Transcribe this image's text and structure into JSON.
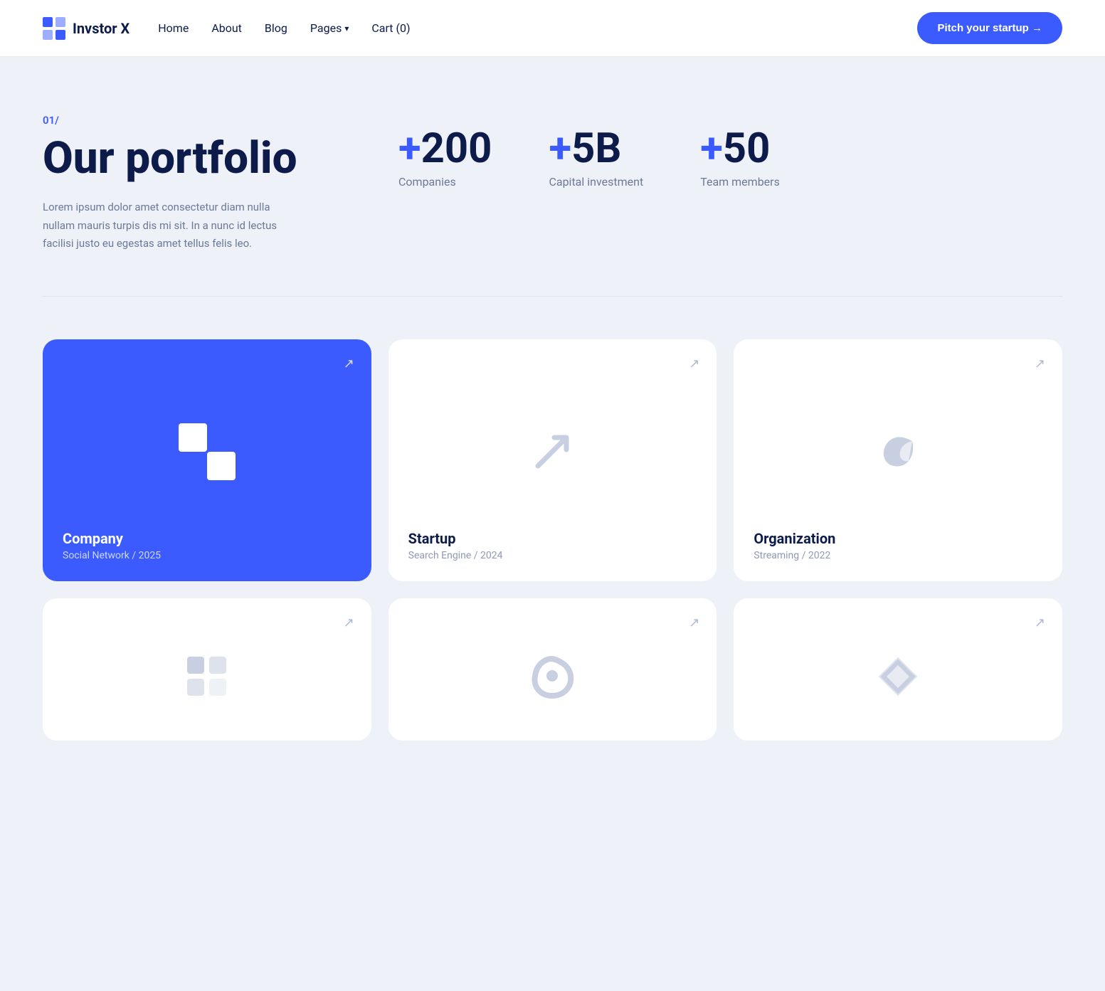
{
  "brand": {
    "name": "Invstor X"
  },
  "nav": {
    "links": [
      {
        "label": "Home",
        "id": "home"
      },
      {
        "label": "About",
        "id": "about"
      },
      {
        "label": "Blog",
        "id": "blog"
      },
      {
        "label": "Pages",
        "id": "pages"
      },
      {
        "label": "Cart (0)",
        "id": "cart"
      }
    ],
    "cta_label": "Pitch your startup →"
  },
  "portfolio": {
    "section_number": "01/",
    "title": "Our portfolio",
    "description": "Lorem ipsum dolor amet consectetur diam nulla nullam mauris turpis dis mi sit. In a nunc id lectus facilisi justo eu egestas amet tellus felis leo.",
    "stats": [
      {
        "value": "+200",
        "label": "Companies"
      },
      {
        "value": "+5B",
        "label": "Capital investment"
      },
      {
        "value": "+50",
        "label": "Team members"
      }
    ]
  },
  "cards": {
    "row1": [
      {
        "id": "card-company",
        "title": "Company",
        "subtitle": "Social Network / 2025",
        "type": "blue",
        "logo_type": "squares"
      },
      {
        "id": "card-startup",
        "title": "Startup",
        "subtitle": "Search Engine / 2024",
        "type": "white",
        "logo_type": "arrow"
      },
      {
        "id": "card-organization",
        "title": "Organization",
        "subtitle": "Streaming / 2022",
        "type": "white",
        "logo_type": "g"
      }
    ],
    "row2": [
      {
        "id": "card-4",
        "title": "",
        "subtitle": "",
        "type": "white",
        "logo_type": "puzzle"
      },
      {
        "id": "card-5",
        "title": "",
        "subtitle": "",
        "type": "white",
        "logo_type": "circle"
      },
      {
        "id": "card-6",
        "title": "",
        "subtitle": "",
        "type": "white",
        "logo_type": "diamond"
      }
    ]
  },
  "arrow_char": "↗"
}
